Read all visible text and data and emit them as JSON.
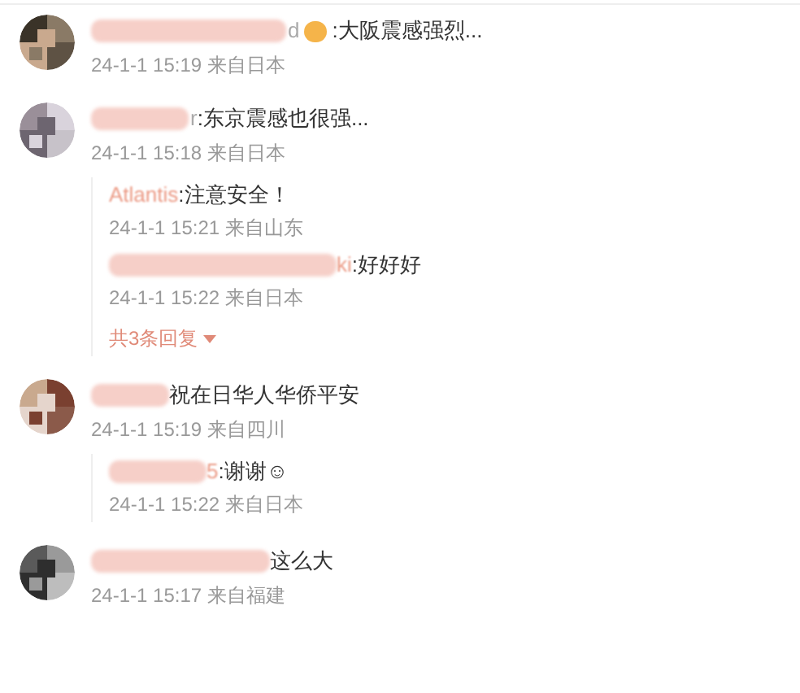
{
  "comments": [
    {
      "name_tail": "d",
      "vip": true,
      "text": ":大阪震感强烈...",
      "time": "24-1-1 15:19 来自日本"
    },
    {
      "name_tail": "r",
      "vip": false,
      "text": ":东京震感也很强...",
      "time": "24-1-1 15:18 来自日本",
      "replies": [
        {
          "name": "Atlantis",
          "text": ":注意安全！",
          "time": "24-1-1 15:21 来自山东"
        },
        {
          "name": "ki",
          "text": ":好好好",
          "time": "24-1-1 15:22 来自日本"
        }
      ],
      "more": "共3条回复"
    },
    {
      "vip": false,
      "text": "祝在日华人华侨平安",
      "time": "24-1-1 15:19 来自四川",
      "replies": [
        {
          "name": "5",
          "text": ":谢谢☺",
          "time": "24-1-1 15:22 来自日本"
        }
      ]
    },
    {
      "vip": false,
      "text": "这么大",
      "time": "24-1-1 15:17 来自福建"
    }
  ]
}
